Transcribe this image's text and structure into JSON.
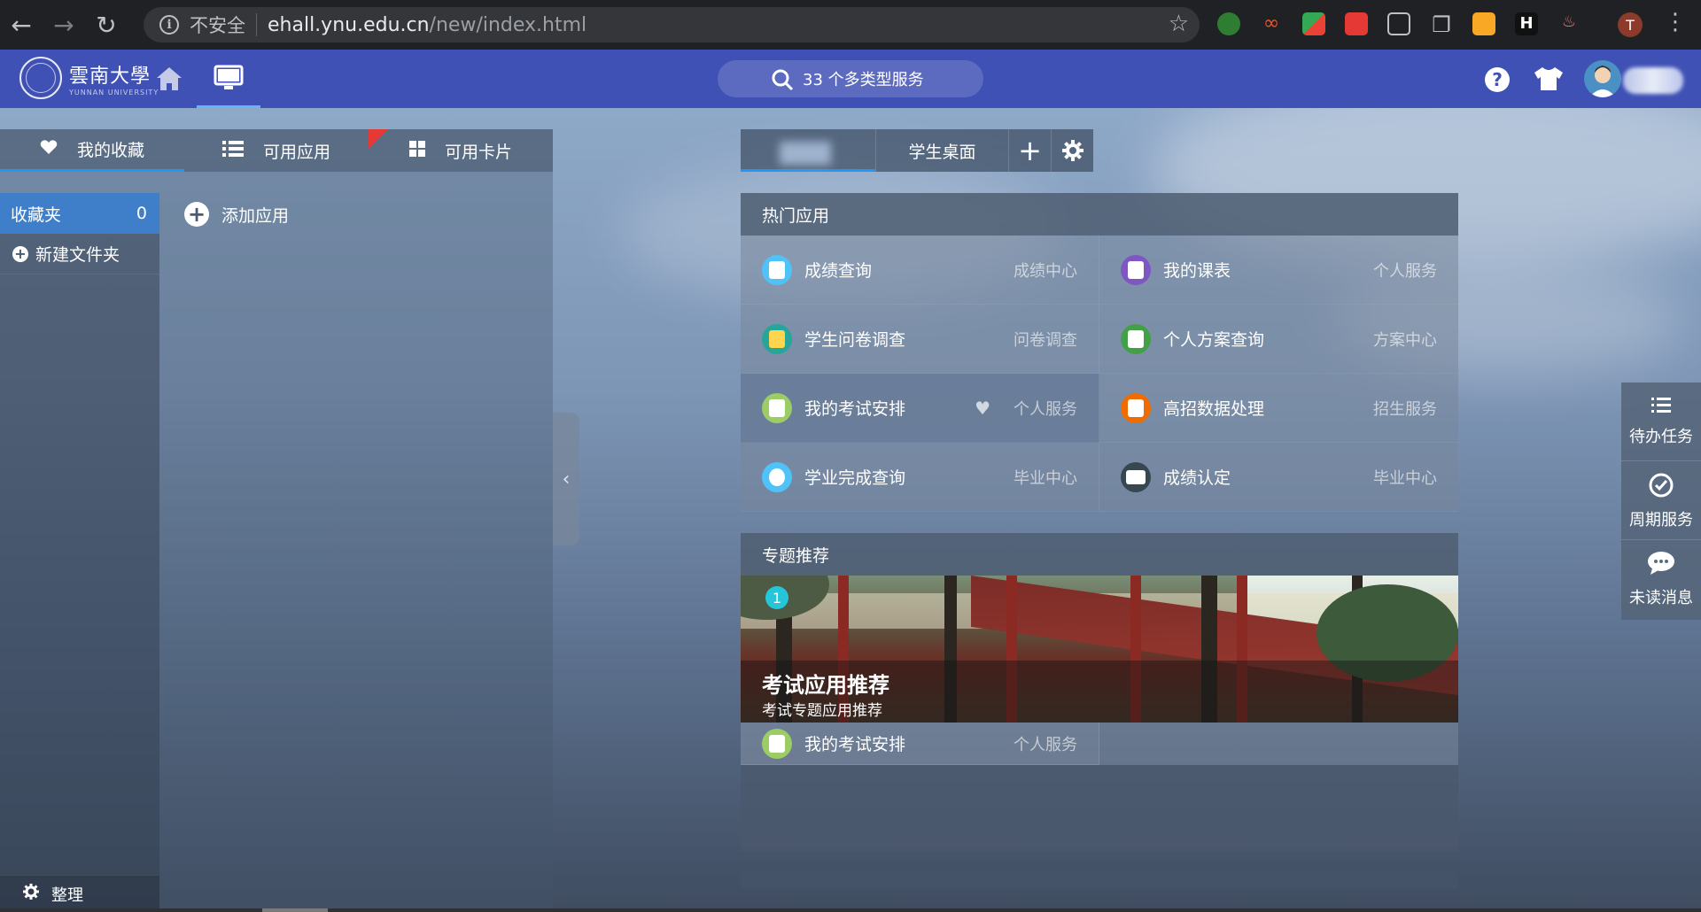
{
  "browser": {
    "security_label": "不安全",
    "url_host": "ehall.ynu.edu.cn",
    "url_path": "/new/index.html",
    "profile_initial": "T"
  },
  "header": {
    "logo_cn": "雲南大學",
    "logo_en": "YUNNAN UNIVERSITY",
    "search_label": "33 个多类型服务",
    "help_label": "?"
  },
  "left_panel": {
    "tabs": [
      {
        "label": "我的收藏",
        "icon": "heart-icon"
      },
      {
        "label": "可用应用",
        "icon": "list-icon"
      },
      {
        "label": "可用卡片",
        "icon": "grid-icon"
      }
    ],
    "folder": {
      "label": "收藏夹",
      "count": "0"
    },
    "new_folder_label": "新建文件夹",
    "add_app_label": "添加应用",
    "organize_label": "整理"
  },
  "desk_tabs": {
    "student_desk": "学生桌面"
  },
  "hot_apps": {
    "title": "热门应用",
    "items": [
      {
        "name": "成绩查询",
        "category": "成绩中心",
        "color": "#4fc3f7"
      },
      {
        "name": "我的课表",
        "category": "个人服务",
        "color": "#7e57c2"
      },
      {
        "name": "学生问卷调查",
        "category": "问卷调查",
        "color": "#26a69a"
      },
      {
        "name": "个人方案查询",
        "category": "方案中心",
        "color": "#43a047"
      },
      {
        "name": "我的考试安排",
        "category": "个人服务",
        "color": "#9ccc65"
      },
      {
        "name": "高招数据处理",
        "category": "招生服务",
        "color": "#ef6c00"
      },
      {
        "name": "学业完成查询",
        "category": "毕业中心",
        "color": "#4fc3f7"
      },
      {
        "name": "成绩认定",
        "category": "毕业中心",
        "color": "#37474f"
      }
    ]
  },
  "topics": {
    "title": "专题推荐",
    "banner_index": "1",
    "banner_title": "考试应用推荐",
    "banner_subtitle": "考试专题应用推荐",
    "app": {
      "name": "我的考试安排",
      "category": "个人服务",
      "color": "#9ccc65"
    }
  },
  "side_panel": {
    "items": [
      {
        "label": "待办任务",
        "icon": "task-list-icon"
      },
      {
        "label": "周期服务",
        "icon": "check-circle-icon"
      },
      {
        "label": "未读消息",
        "icon": "chat-icon"
      }
    ]
  }
}
